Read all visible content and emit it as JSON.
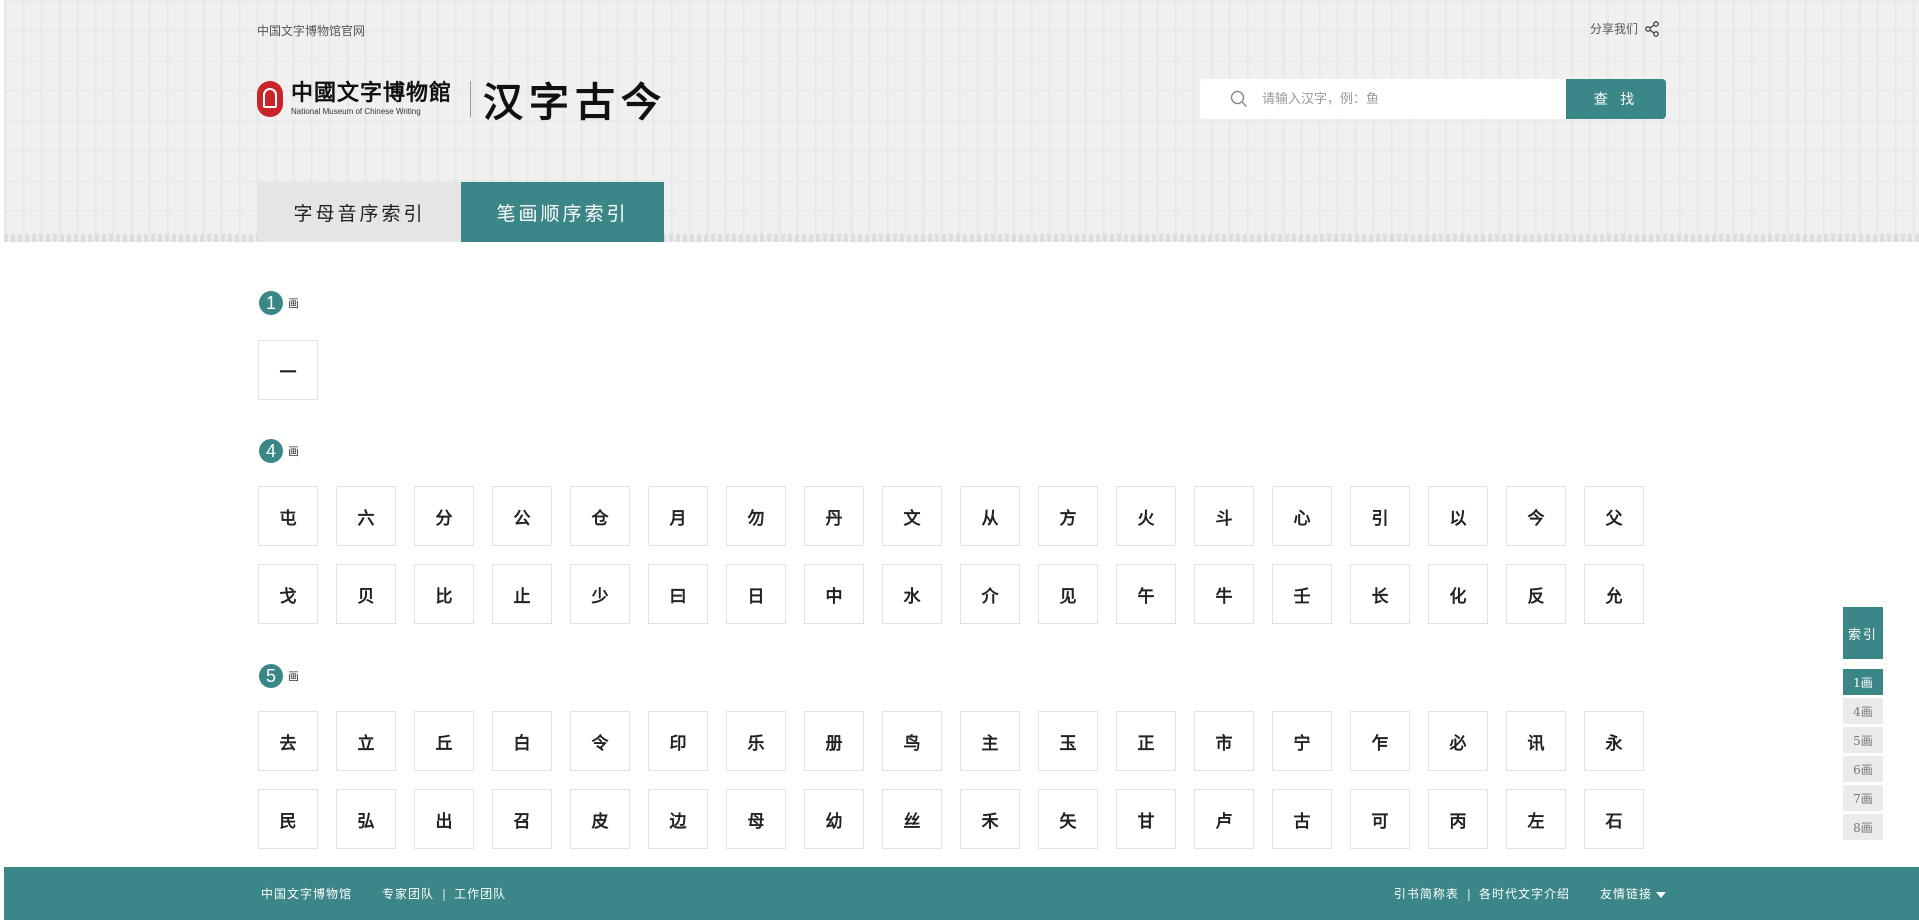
{
  "header": {
    "top_link": "中国文字博物馆官网",
    "share_label": "分享我们",
    "logo_cn": "中國文字博物館",
    "logo_en": "National Museum of Chinese Writing",
    "site_title": "汉字古今"
  },
  "search": {
    "placeholder": "请输入汉字，例：鱼",
    "value": "",
    "button_label": "查 找"
  },
  "tabs": [
    {
      "label": "字母音序索引",
      "active": false
    },
    {
      "label": "笔画顺序索引",
      "active": true
    }
  ],
  "sections": [
    {
      "number": "1",
      "label": "画",
      "rows": [
        [
          "一"
        ]
      ]
    },
    {
      "number": "4",
      "label": "画",
      "rows": [
        [
          "屯",
          "六",
          "分",
          "公",
          "仓",
          "月",
          "勿",
          "丹",
          "文",
          "从",
          "方",
          "火",
          "斗",
          "心",
          "引",
          "以",
          "今",
          "父"
        ],
        [
          "戈",
          "贝",
          "比",
          "止",
          "少",
          "曰",
          "日",
          "中",
          "水",
          "介",
          "见",
          "午",
          "牛",
          "壬",
          "长",
          "化",
          "反",
          "允"
        ]
      ]
    },
    {
      "number": "5",
      "label": "画",
      "rows": [
        [
          "去",
          "立",
          "丘",
          "白",
          "令",
          "印",
          "乐",
          "册",
          "鸟",
          "主",
          "玉",
          "正",
          "市",
          "宁",
          "乍",
          "必",
          "讯",
          "永"
        ],
        [
          "民",
          "弘",
          "出",
          "召",
          "皮",
          "边",
          "母",
          "幼",
          "丝",
          "禾",
          "矢",
          "甘",
          "卢",
          "古",
          "可",
          "丙",
          "左",
          "石"
        ]
      ]
    }
  ],
  "side_index": {
    "title": "索引",
    "items": [
      {
        "label": "1画",
        "active": true
      },
      {
        "label": "4画",
        "active": false
      },
      {
        "label": "5画",
        "active": false
      },
      {
        "label": "6画",
        "active": false
      },
      {
        "label": "7画",
        "active": false
      },
      {
        "label": "8画",
        "active": false
      }
    ]
  },
  "footer": {
    "left": [
      "中国文字博物馆",
      "专家团队",
      "工作团队"
    ],
    "right": [
      "引书简称表",
      "各时代文字介绍"
    ],
    "dropdown": "友情链接",
    "separator": "|"
  },
  "colors": {
    "accent": "#3b8686",
    "header_bg": "#f1f0f0",
    "seal_red": "#c8242a"
  }
}
